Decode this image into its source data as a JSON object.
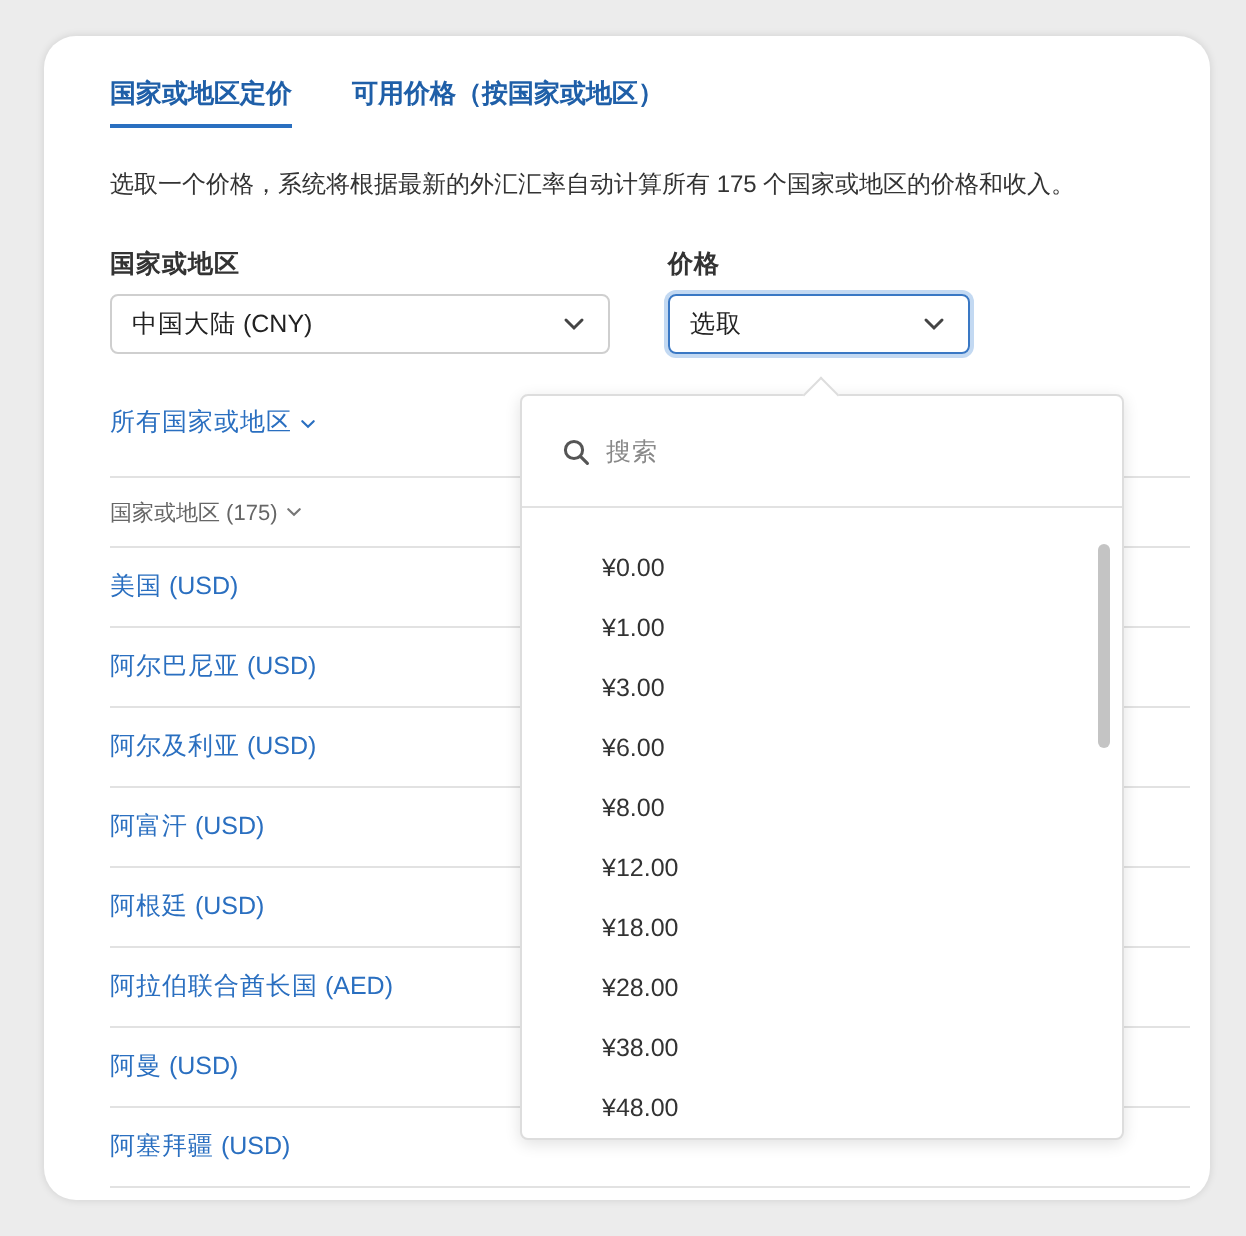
{
  "tabs": [
    {
      "label": "国家或地区定价",
      "selected": true
    },
    {
      "label": "可用价格（按国家或地区）",
      "selected": false
    }
  ],
  "description": "选取一个价格，系统将根据最新的外汇汇率自动计算所有 175 个国家或地区的价格和收入。",
  "country_field": {
    "label": "国家或地区",
    "value": "中国大陆 (CNY)"
  },
  "price_field": {
    "label": "价格",
    "value": "选取",
    "expanded": true
  },
  "filter_link": "所有国家或地区",
  "table": {
    "header": "国家或地区 (175)",
    "rows": [
      "美国 (USD)",
      "阿尔巴尼亚 (USD)",
      "阿尔及利亚 (USD)",
      "阿富汗 (USD)",
      "阿根廷 (USD)",
      "阿拉伯联合酋长国 (AED)",
      "阿曼 (USD)",
      "阿塞拜疆 (USD)"
    ]
  },
  "price_popup": {
    "search": {
      "placeholder": "搜索"
    },
    "options": [
      "¥0.00",
      "¥1.00",
      "¥3.00",
      "¥6.00",
      "¥8.00",
      "¥12.00",
      "¥18.00",
      "¥28.00",
      "¥38.00",
      "¥48.00"
    ]
  }
}
